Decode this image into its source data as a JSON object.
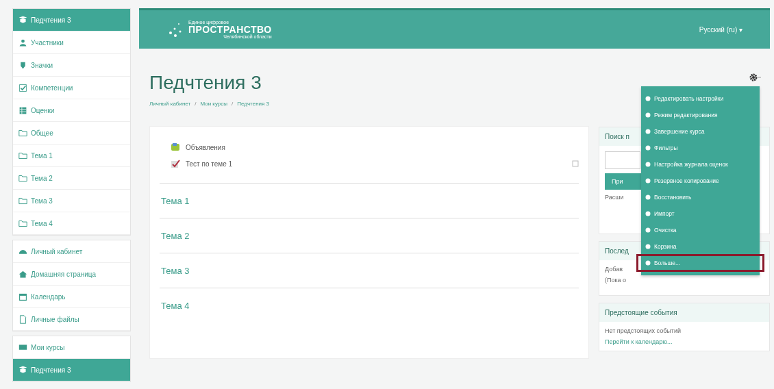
{
  "sidebar": {
    "groups": [
      {
        "items": [
          {
            "label": "Педчтения 3",
            "selected": true
          },
          {
            "label": "Участники",
            "selected": false
          },
          {
            "label": "Значки",
            "selected": false
          },
          {
            "label": "Компетенции",
            "selected": false
          },
          {
            "label": "Оценки",
            "selected": false
          },
          {
            "label": "Общее",
            "selected": false
          },
          {
            "label": "Тема 1",
            "selected": false
          },
          {
            "label": "Тема 2",
            "selected": false
          },
          {
            "label": "Тема 3",
            "selected": false
          },
          {
            "label": "Тема 4",
            "selected": false
          }
        ]
      },
      {
        "items": [
          {
            "label": "Личный кабинет",
            "selected": false
          },
          {
            "label": "Домашняя страница",
            "selected": false
          },
          {
            "label": "Календарь",
            "selected": false
          },
          {
            "label": "Личные файлы",
            "selected": false
          }
        ]
      },
      {
        "items": [
          {
            "label": "Мои курсы",
            "selected": false
          },
          {
            "label": "Педчтения 3",
            "selected": true
          }
        ]
      }
    ]
  },
  "header": {
    "logo_top": "Единое цифровое",
    "logo_main": "ПРОСТРАНСТВО",
    "logo_sub": "Челябинской области",
    "language": "Русский (ru) ▾"
  },
  "page": {
    "title": "Педчтения 3",
    "breadcrumb": [
      "Личный кабинет",
      "Мои курсы",
      "Педчтения 3"
    ],
    "separator": "/"
  },
  "course": {
    "activities": [
      {
        "label": "Объявления"
      },
      {
        "label": "Тест по теме 1"
      }
    ],
    "sections": [
      "Тема 1",
      "Тема 2",
      "Тема 3",
      "Тема 4"
    ]
  },
  "settings_menu": {
    "items": [
      {
        "label": "Редактировать настройки",
        "selected": false
      },
      {
        "label": "Режим редактирования",
        "selected": false
      },
      {
        "label": "Завершение курса",
        "selected": false
      },
      {
        "label": "Фильтры",
        "selected": false
      },
      {
        "label": "Настройка журнала оценок",
        "selected": false
      },
      {
        "label": "Резервное копирование",
        "selected": false
      },
      {
        "label": "Восстановить",
        "selected": false
      },
      {
        "label": "Импорт",
        "selected": false
      },
      {
        "label": "Очистка",
        "selected": false
      },
      {
        "label": "Корзина",
        "selected": false
      },
      {
        "label": "Больше...",
        "selected": true
      }
    ]
  },
  "blocks": [
    {
      "title": "Поиск п",
      "button": "При",
      "text": "Расши"
    },
    {
      "title": "Послед",
      "lines": [
        "Добав",
        "(Пока о"
      ]
    },
    {
      "title": "Предстоящие события",
      "text": "Нет предстоящих событий",
      "link": "Перейти к календарю..."
    }
  ]
}
